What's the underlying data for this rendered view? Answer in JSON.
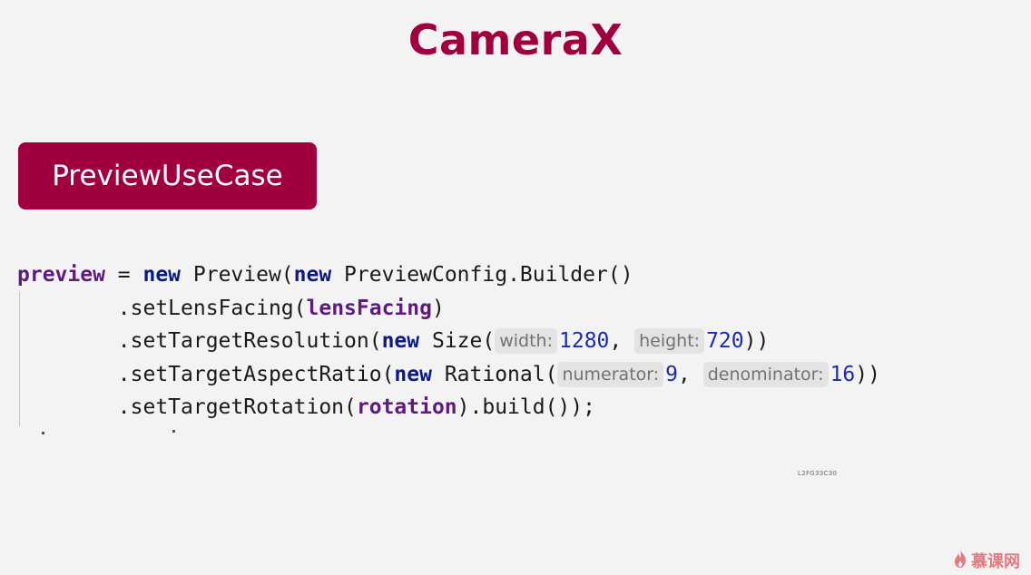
{
  "slide": {
    "title": "CameraX",
    "section_label": "PreviewUseCase"
  },
  "code": {
    "line1": {
      "var": "preview",
      "eq": " = ",
      "kw1": "new",
      "t1": " Preview(",
      "kw2": "new",
      "t2": " PreviewConfig.Builder()"
    },
    "line2": {
      "pre": "        .setLensFacing(",
      "var": "lensFacing",
      "post": ")"
    },
    "line3": {
      "pre": "        .setTargetResolution(",
      "kw": "new",
      "mid": " Size(",
      "hint1": "width:",
      "num1": "1280",
      "sep": ", ",
      "hint2": "height:",
      "num2": "720",
      "post": "))"
    },
    "line4": {
      "pre": "        .setTargetAspectRatio(",
      "kw": "new",
      "mid": " Rational(",
      "hint1": "numerator:",
      "num1": "9",
      "sep": ", ",
      "hint2": "denominator:",
      "num2": "16",
      "post": "))"
    },
    "line5": {
      "pre": "        .setTargetRotation(",
      "var": "rotation",
      "post": ").build());"
    }
  },
  "overlay_tag": "L2FG33C30",
  "watermark": {
    "text": "慕课网",
    "icon": "flame-logo-icon",
    "color": "#e15b64"
  },
  "colors": {
    "accent": "#a0003f",
    "keyword": "#0b1a85",
    "variable": "#5e1b7e",
    "number": "#1b2ab3",
    "background": "#f3f3f3"
  }
}
